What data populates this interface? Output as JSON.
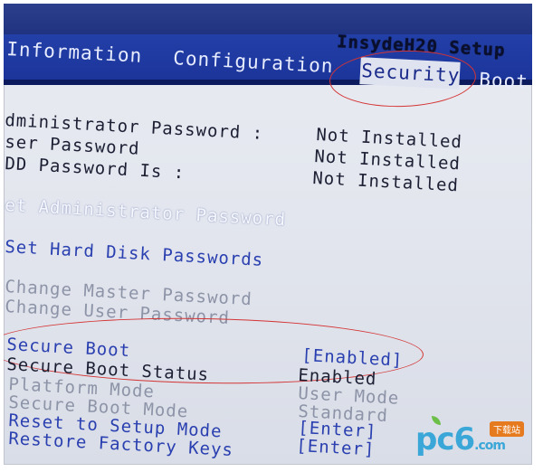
{
  "app_title": "InsydeH20 Setup",
  "menu": [
    {
      "label": "Information"
    },
    {
      "label": "Configuration"
    },
    {
      "label": "Security",
      "active": true
    },
    {
      "label": "Boot"
    }
  ],
  "passwords": [
    {
      "label": "dministrator Password  :",
      "value": "Not Installed"
    },
    {
      "label": "ser Password",
      "value": "Not Installed"
    },
    {
      "label": "DD Password Is  :",
      "value": "Not Installed"
    }
  ],
  "actions": {
    "set_admin": "et Administrator Password",
    "set_hdd": "Set Hard Disk Passwords",
    "change_master": "Change Master Password",
    "change_user": "Change User Password"
  },
  "secure_boot": [
    {
      "label": "Secure Boot",
      "value": "[Enabled]"
    },
    {
      "label": "Secure Boot Status",
      "value": "Enabled"
    },
    {
      "label": "Platform Mode",
      "value": "User Mode"
    },
    {
      "label": "Secure Boot Mode",
      "value": "Standard"
    },
    {
      "label": "Reset to Setup Mode",
      "value": "[Enter]"
    },
    {
      "label": "Restore Factory Keys",
      "value": "[Enter]"
    }
  ],
  "watermark": {
    "brand": "pc6",
    "suffix": ".com",
    "badge": "下载站"
  },
  "colors": {
    "menu_bar": "#1b349a",
    "highlight_circle": "#d43434",
    "screen": "#e3e6ee"
  }
}
